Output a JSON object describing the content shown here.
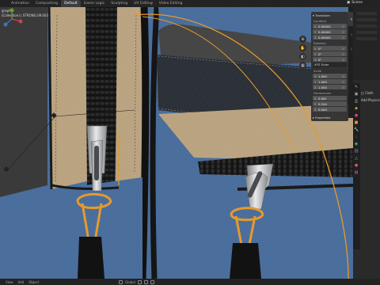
{
  "workspace_tabs": [
    "Animation",
    "Compositing",
    "Default",
    "Game Logic",
    "Sculpting",
    "UV Editing",
    "Video Editing"
  ],
  "active_tab_index": 2,
  "scene": {
    "label": "Scene"
  },
  "viewport_info": {
    "line1": "graphic",
    "line2": "(Collection) | STRONG.09.003"
  },
  "npanel": {
    "title": "Transform",
    "location_label": "Location",
    "location": [
      {
        "axis": "X",
        "value": "0.00000"
      },
      {
        "axis": "Y",
        "value": "0.00000"
      },
      {
        "axis": "Z",
        "value": "0.00000"
      }
    ],
    "rotation_label": "Rotation",
    "rotation": [
      {
        "axis": "X",
        "value": "0°"
      },
      {
        "axis": "Y",
        "value": "0°"
      },
      {
        "axis": "Z",
        "value": "0°"
      }
    ],
    "rotation_mode": "XYZ Euler",
    "scale_label": "Scale",
    "scale": [
      {
        "axis": "X",
        "value": "1.000"
      },
      {
        "axis": "Y",
        "value": "1.000"
      },
      {
        "axis": "Z",
        "value": "1.000"
      }
    ],
    "dimensions_label": "Dimensions",
    "dimensions": [
      {
        "axis": "X",
        "value": "0.061"
      },
      {
        "axis": "Y",
        "value": "0.244"
      },
      {
        "axis": "Z",
        "value": "0.000"
      }
    ],
    "properties_label": "Properties"
  },
  "properties_panel": {
    "items": [
      "Cloth",
      "Add Physics"
    ]
  },
  "statusbar": {
    "menus": [
      "View",
      "Add",
      "Object"
    ],
    "transform_mode": "Global"
  },
  "colors": {
    "viewport_bg": "#3e5f8e",
    "fabric_tan": "#b59e7c",
    "zipper_orange": "#e79a2a",
    "zipper_black": "#1a1a1a"
  }
}
